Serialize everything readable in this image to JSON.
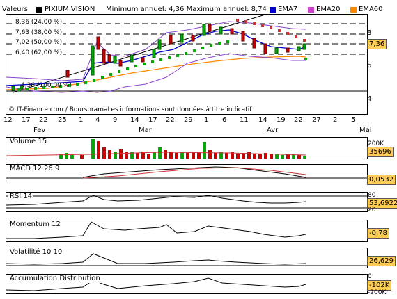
{
  "header": {
    "values_label": "Valeurs",
    "stock_name": "PIXIUM VISION",
    "min_max_text": "Minimum annuel: 4,36 Maximum annuel: 8,74",
    "ema7": "EMA7",
    "ema20": "EMA20",
    "ema60": "EMA60",
    "colors": {
      "ema7": "#0000cc",
      "ema20": "#cc44cc",
      "ema60": "#ff8800",
      "up": "#00aa00",
      "down": "#cc0000"
    }
  },
  "main_chart": {
    "fib_levels": [
      "8,36 (24,00 %)",
      "7,63 (38,00 %)",
      "7,02 (50,00 %)",
      "6,40 (62,00 %)",
      "4,36 (100,00 %)"
    ],
    "y_ticks": [
      "8",
      "6",
      "4"
    ],
    "last_value": "7,36",
    "credit": "© IT-Finance.com / BoursoramaLes informations sont données à titre indicatif"
  },
  "x_axis": {
    "days": [
      "12",
      "17",
      "22",
      "25",
      "1",
      "4",
      "9",
      "14",
      "17",
      "22",
      "29",
      "1",
      "6",
      "11",
      "14",
      "19",
      "22",
      "27",
      "2",
      "5"
    ],
    "months": [
      "Fev",
      "Mar",
      "Avr",
      "Mai"
    ]
  },
  "panels": {
    "volume": {
      "title": "Volume 15",
      "scale": "200K",
      "value": "35696"
    },
    "macd": {
      "title": "MACD 12 26 9",
      "value": "0,0532"
    },
    "rsi": {
      "title": "RSI 14",
      "top": "80",
      "bottom": "20",
      "value": "53,6922"
    },
    "momentum": {
      "title": "Momentum 12",
      "value": "-0,78"
    },
    "volatility": {
      "title": "Volatilité 10 10",
      "value": "26,629"
    },
    "accumulation": {
      "title": "Accumulation Distribution",
      "top": "0",
      "bottom": "-200K",
      "value": "-102K"
    }
  }
}
